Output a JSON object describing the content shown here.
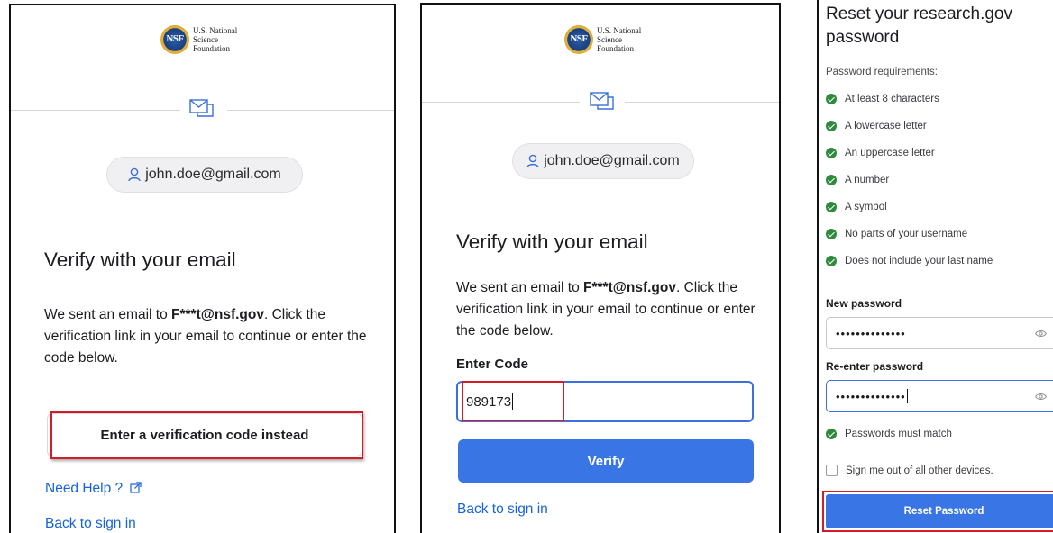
{
  "logo": {
    "seal_text": "NSF",
    "line1": "U.S. National",
    "line2": "Science",
    "line3": "Foundation"
  },
  "panel1": {
    "email": "john.doe@gmail.com",
    "heading": "Verify with your email",
    "text_before": "We sent an email to ",
    "masked_email": "F***t@nsf.gov",
    "text_after": ". Click the verification link in your email to continue or enter the code below.",
    "code_button": "Enter a verification code instead",
    "need_help": "Need Help ?",
    "back_link": "Back to sign in"
  },
  "panel2": {
    "email": "john.doe@gmail.com",
    "heading": "Verify with your email",
    "text_before": "We sent an email to ",
    "masked_email": "F***t@nsf.gov",
    "text_after": ". Click the verification link in your email to continue or enter the code below.",
    "code_label": "Enter Code",
    "code_value": "989173",
    "verify_button": "Verify",
    "back_link": "Back to sign in"
  },
  "panel3": {
    "title": "Reset your research.gov password",
    "requirements_label": "Password requirements:",
    "requirements": [
      "At least 8 characters",
      "A lowercase letter",
      "An uppercase letter",
      "A number",
      "A symbol",
      "No parts of your username",
      "Does not include your last name"
    ],
    "new_password_label": "New password",
    "new_password_value": "••••••••••••••",
    "reenter_label": "Re-enter password",
    "reenter_value": "••••••••••••••",
    "match_text": "Passwords must match",
    "signout_text": "Sign me out of all other devices.",
    "reset_button": "Reset Password"
  },
  "colors": {
    "link": "#1662dd",
    "primary_button": "#3a75e6",
    "highlight_box": "#d31c2a",
    "check_green": "#2f8a3d"
  }
}
